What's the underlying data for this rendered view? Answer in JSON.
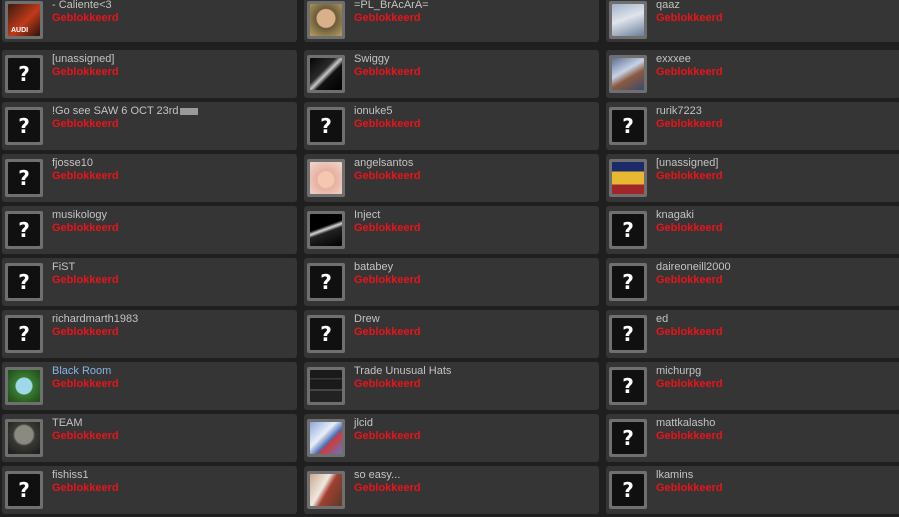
{
  "status_text": "Geblokkeerd",
  "columns": [
    [
      {
        "name": "- Caliente<3",
        "avatar": "audi-logo-image"
      },
      {
        "name": "[unassigned]",
        "avatar": "unknown"
      },
      {
        "name": "!Go see SAW 6 OCT 23rd",
        "avatar": "unknown",
        "redacted": true
      },
      {
        "name": "fjosse10",
        "avatar": "unknown"
      },
      {
        "name": "musikology",
        "avatar": "unknown"
      },
      {
        "name": "FiST",
        "avatar": "unknown"
      },
      {
        "name": "richardmarth1983",
        "avatar": "unknown"
      },
      {
        "name": "Black Room",
        "avatar": "green-character-image",
        "online": true
      },
      {
        "name": "TEAM",
        "avatar": "soldier-image"
      },
      {
        "name": "fishiss1",
        "avatar": "unknown"
      }
    ],
    [
      {
        "name": "=PL_BrAcArA=",
        "avatar": "face-photo-image"
      },
      {
        "name": "Swiggy",
        "avatar": "dark-abstract-image"
      },
      {
        "name": "ionuke5",
        "avatar": "unknown"
      },
      {
        "name": "angelsantos",
        "avatar": "pink-character-image"
      },
      {
        "name": "Inject",
        "avatar": "car-image"
      },
      {
        "name": "batabey",
        "avatar": "unknown"
      },
      {
        "name": "Drew",
        "avatar": "unknown"
      },
      {
        "name": "Trade Unusual Hats",
        "avatar": "room-image"
      },
      {
        "name": "jlcid",
        "avatar": "jet-image"
      },
      {
        "name": "so easy...",
        "avatar": "helmet-image"
      }
    ],
    [
      {
        "name": "qaaz",
        "avatar": "anime-image"
      },
      {
        "name": "exxxee",
        "avatar": "bird-image"
      },
      {
        "name": "rurik7223",
        "avatar": "unknown"
      },
      {
        "name": "[unassigned]",
        "avatar": "pixel-character-image"
      },
      {
        "name": "knagaki",
        "avatar": "unknown"
      },
      {
        "name": "daireoneill2000",
        "avatar": "unknown"
      },
      {
        "name": "ed",
        "avatar": "unknown"
      },
      {
        "name": "michurpg",
        "avatar": "unknown"
      },
      {
        "name": "mattkalasho",
        "avatar": "unknown"
      },
      {
        "name": "lkamins",
        "avatar": "unknown"
      }
    ]
  ],
  "colors": {
    "background": "#1f1f1f",
    "card": "#353535",
    "name": "#c3c3c3",
    "online_name": "#86b4e6",
    "status": "#e8141b"
  }
}
